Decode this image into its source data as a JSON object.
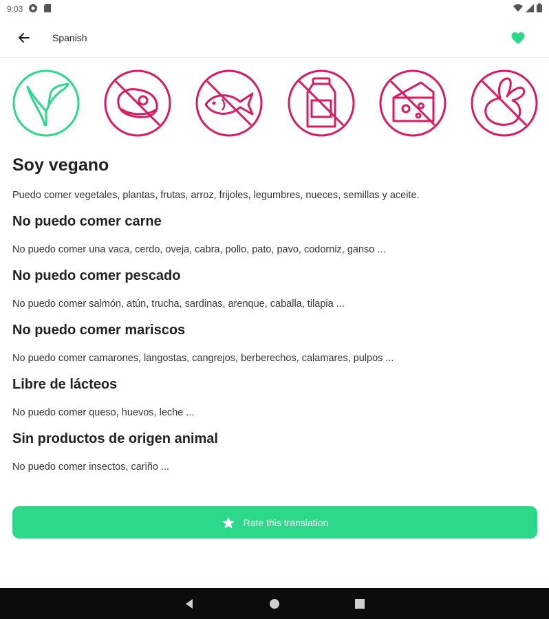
{
  "status_bar": {
    "time": "9:03"
  },
  "app_bar": {
    "title": "Spanish"
  },
  "icons": [
    {
      "name": "vegan-sprout-icon",
      "color": "#2cd889"
    },
    {
      "name": "no-meat-icon",
      "color": "#d81b60"
    },
    {
      "name": "no-fish-icon",
      "color": "#d81b60"
    },
    {
      "name": "no-milk-icon",
      "color": "#d81b60"
    },
    {
      "name": "no-cheese-icon",
      "color": "#d81b60"
    },
    {
      "name": "no-rabbit-icon",
      "color": "#d81b60"
    }
  ],
  "main": {
    "title": "Soy vegano",
    "description": "Puedo comer vegetales, plantas, frutas, arroz, frijoles, legumbres, nueces, semillas y aceite."
  },
  "sections": [
    {
      "title": "No puedo comer carne",
      "description": "No puedo comer una vaca, cerdo, oveja, cabra, pollo, pato, pavo, codorniz, ganso ..."
    },
    {
      "title": "No puedo comer pescado",
      "description": "No puedo comer salmón, atún, trucha, sardinas, arenque, caballa, tilapia ..."
    },
    {
      "title": "No puedo comer mariscos",
      "description": "No puedo comer camarones, langostas, cangrejos, berberechos, calamares, pulpos ..."
    },
    {
      "title": "Libre de lácteos",
      "description": "No puedo comer queso, huevos, leche ..."
    },
    {
      "title": "Sin productos de origen animal",
      "description": "No puedo comer insectos, cariño ..."
    }
  ],
  "rate_button": {
    "label": "Rate this translation",
    "color": "#2cd889"
  },
  "colors": {
    "accent": "#2cd889",
    "prohibited": "#d81b60"
  }
}
